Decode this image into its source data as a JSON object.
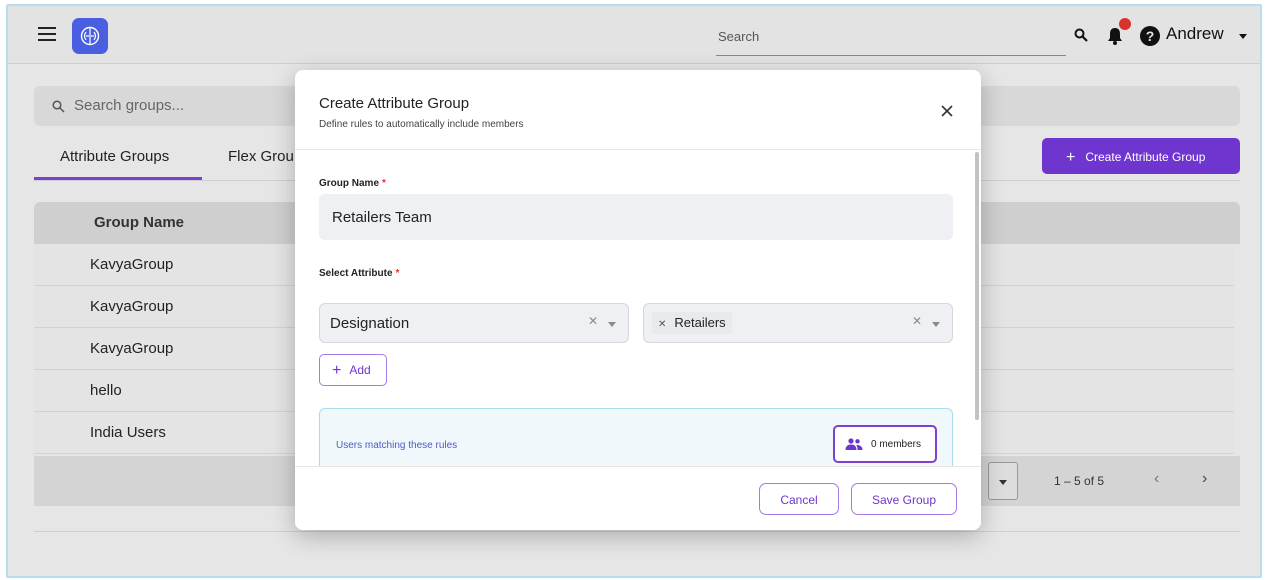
{
  "header": {
    "search_placeholder": "Search",
    "user_name": "Andrew"
  },
  "page": {
    "search_placeholder": "Search groups...",
    "tabs": [
      {
        "label": "Attribute Groups",
        "active": true
      },
      {
        "label": "Flex Grou",
        "active": false
      }
    ],
    "create_button_label": "Create Attribute Group",
    "table": {
      "column_header": "Group Name",
      "rows": [
        "KavyaGroup",
        "KavyaGroup",
        "KavyaGroup",
        "hello",
        "India Users"
      ]
    },
    "pagination": {
      "range_text": "1 – 5 of 5",
      "prev": "‹",
      "next": "›"
    }
  },
  "modal": {
    "title": "Create Attribute Group",
    "subtitle": "Define rules to automatically include members",
    "group_name_label": "Group Name",
    "group_name_value": "Retailers Team",
    "required_mark": "*",
    "select_attribute_label": "Select Attribute",
    "attribute_value": "Designation",
    "attribute_value_chip": "Retailers",
    "add_button_label": "Add",
    "rules_text": "Users matching these rules",
    "members_count_label": "0 members",
    "cancel_label": "Cancel",
    "save_label": "Save Group"
  },
  "colors": {
    "accent": "#6f35cf",
    "logo": "#4a5fe0",
    "notification": "#d9342b",
    "rules_text": "#5059c9"
  }
}
